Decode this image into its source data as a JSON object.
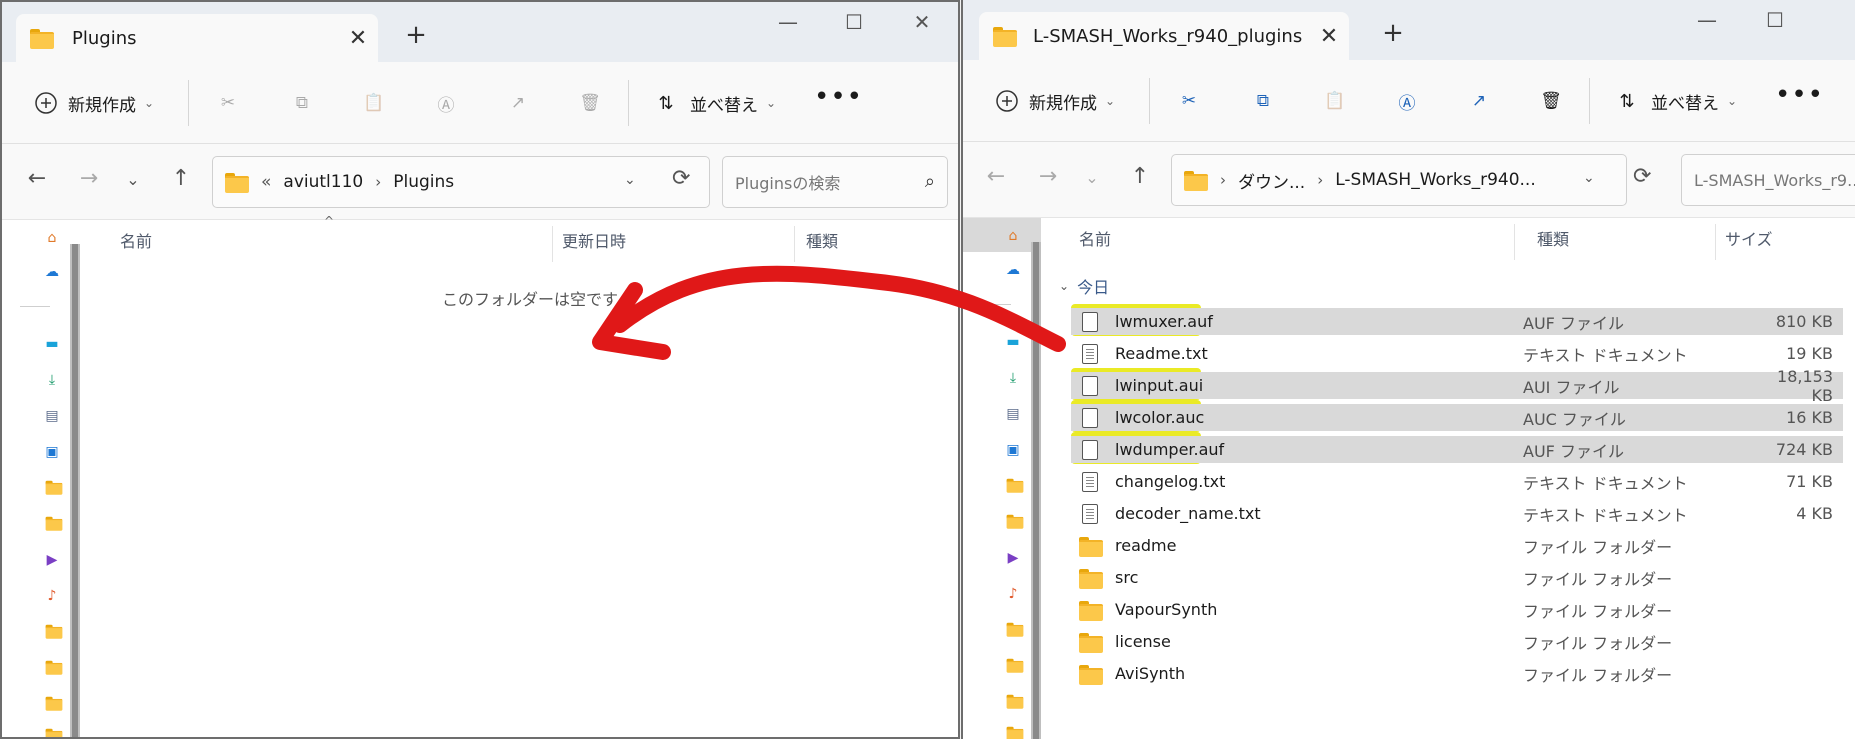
{
  "left": {
    "tab_title": "Plugins",
    "toolbar": {
      "new_label": "新規作成",
      "sort_label": "並べ替え",
      "more": "•••"
    },
    "address": {
      "overflow": "«",
      "segments": [
        "aviutl110",
        "Plugins"
      ]
    },
    "search_placeholder": "Pluginsの検索",
    "columns": {
      "name": "名前",
      "date": "更新日時",
      "type": "種類"
    },
    "empty_message": "このフォルダーは空です。"
  },
  "right": {
    "tab_title": "L-SMASH_Works_r940_plugins",
    "toolbar": {
      "new_label": "新規作成",
      "sort_label": "並べ替え",
      "more": "•••"
    },
    "address": {
      "segments": [
        "ダウン...",
        "L-SMASH_Works_r940..."
      ]
    },
    "search_placeholder": "L-SMASH_Works_r9...",
    "columns": {
      "name": "名前",
      "type": "種類",
      "size": "サイズ"
    },
    "group_label": "今日",
    "files": [
      {
        "name": "lwmuxer.auf",
        "type": "AUF ファイル",
        "size": "810 KB",
        "icon": "file",
        "selected": true
      },
      {
        "name": "Readme.txt",
        "type": "テキスト ドキュメント",
        "size": "19 KB",
        "icon": "text",
        "selected": false
      },
      {
        "name": "lwinput.aui",
        "type": "AUI ファイル",
        "size": "18,153 KB",
        "icon": "file",
        "selected": true
      },
      {
        "name": "lwcolor.auc",
        "type": "AUC ファイル",
        "size": "16 KB",
        "icon": "file",
        "selected": true
      },
      {
        "name": "lwdumper.auf",
        "type": "AUF ファイル",
        "size": "724 KB",
        "icon": "file",
        "selected": true
      },
      {
        "name": "changelog.txt",
        "type": "テキスト ドキュメント",
        "size": "71 KB",
        "icon": "text",
        "selected": false
      },
      {
        "name": "decoder_name.txt",
        "type": "テキスト ドキュメント",
        "size": "4 KB",
        "icon": "text",
        "selected": false
      },
      {
        "name": "readme",
        "type": "ファイル フォルダー",
        "size": "",
        "icon": "folder",
        "selected": false
      },
      {
        "name": "src",
        "type": "ファイル フォルダー",
        "size": "",
        "icon": "folder",
        "selected": false
      },
      {
        "name": "VapourSynth",
        "type": "ファイル フォルダー",
        "size": "",
        "icon": "folder",
        "selected": false
      },
      {
        "name": "license",
        "type": "ファイル フォルダー",
        "size": "",
        "icon": "folder",
        "selected": false
      },
      {
        "name": "AviSynth",
        "type": "ファイル フォルダー",
        "size": "",
        "icon": "folder",
        "selected": false
      }
    ]
  },
  "colors": {
    "highlight": "#e6e600",
    "arrow": "#e01818",
    "selection": "#d9d9d9"
  }
}
